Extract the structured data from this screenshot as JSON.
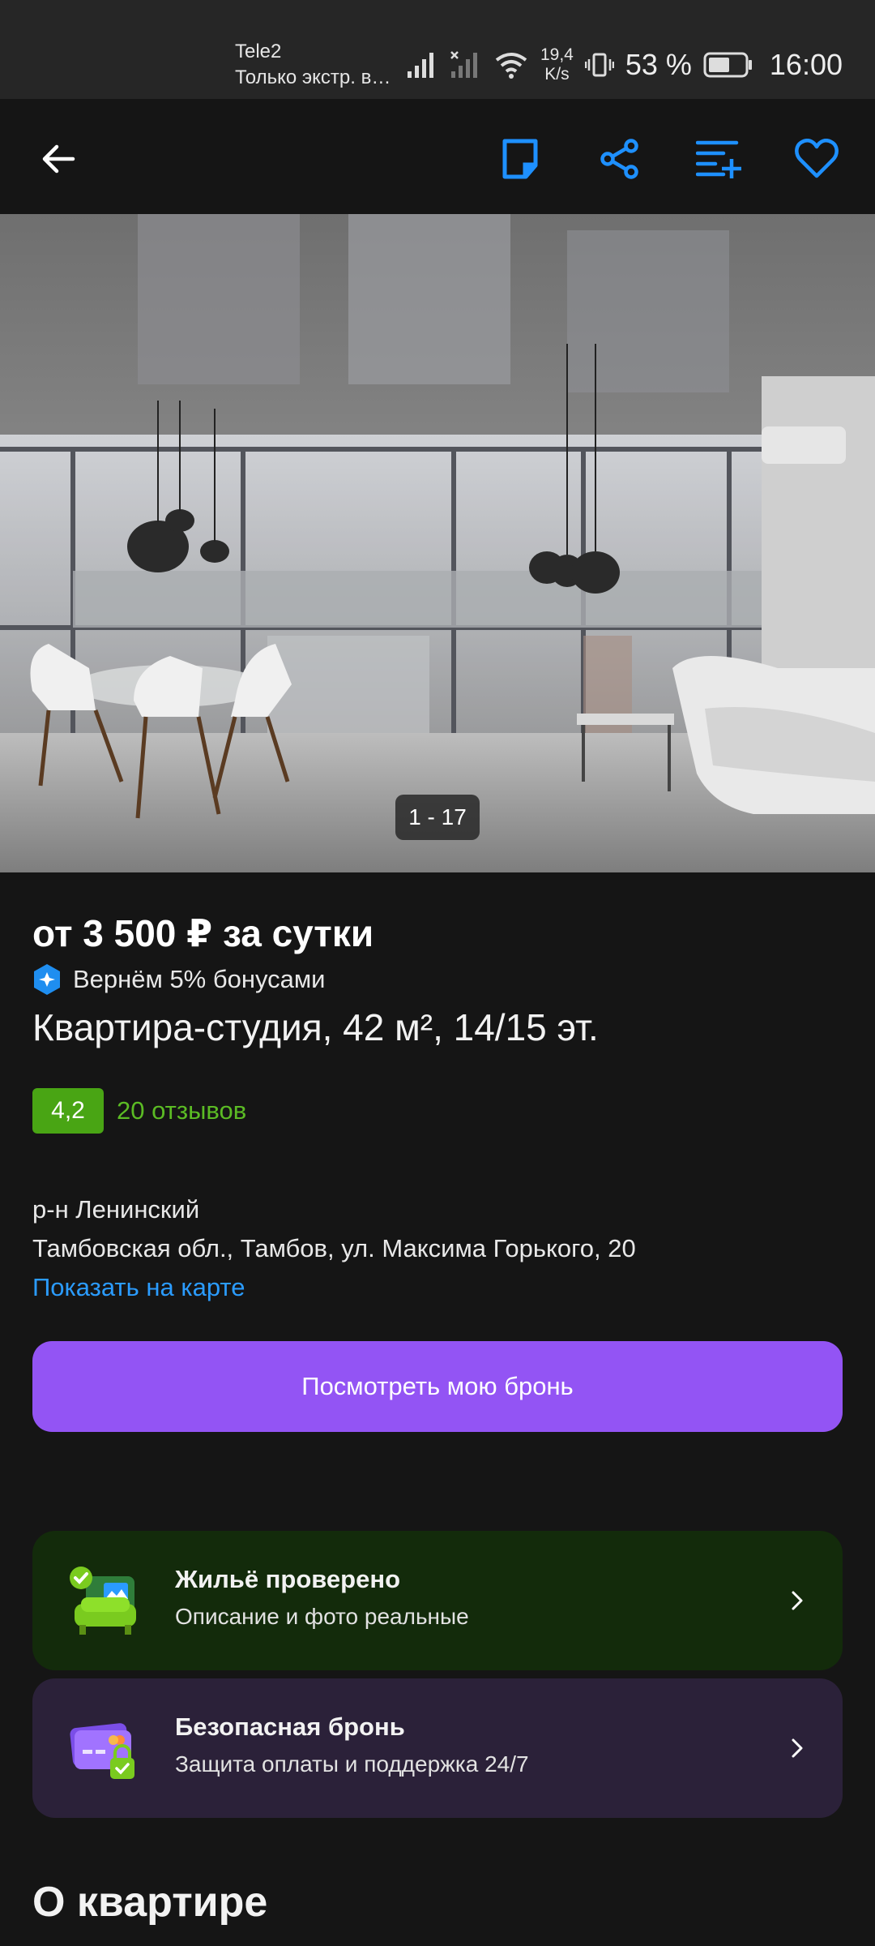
{
  "status_bar": {
    "carrier": "Tele2",
    "carrier_status": "Только экстр. в…",
    "speed_value": "19,4",
    "speed_unit": "K/s",
    "battery_percent": "53 %",
    "time": "16:00"
  },
  "nav": {
    "back_icon": "arrow-left-icon",
    "icons": [
      "note-icon",
      "share-icon",
      "compare-list-icon",
      "heart-icon"
    ],
    "accent_color": "#1e90ff"
  },
  "gallery": {
    "counter": "1 - 17"
  },
  "listing": {
    "price": "от 3 500 ₽ за сутки",
    "bonus": "Вернём 5% бонусами",
    "title": "Квартира-студия, 42 м², 14/15 эт.",
    "rating": "4,2",
    "reviews": "20 отзывов",
    "district": "р-н Ленинский",
    "address": "Тамбовская обл., Тамбов, ул. Максима Горького, 20",
    "map_link": "Показать на карте",
    "booking_button": "Посмотреть мою бронь"
  },
  "cards": [
    {
      "title": "Жильё проверено",
      "subtitle": "Описание и фото реальные",
      "icon": "verified-home-icon",
      "bg": "#132b0b"
    },
    {
      "title": "Безопасная бронь",
      "subtitle": "Защита оплаты и поддержка 24/7",
      "icon": "secure-card-icon",
      "bg": "#2b2139"
    }
  ],
  "section": {
    "title": "О квартире"
  },
  "colors": {
    "background": "#151515",
    "booking_button": "#9354f4",
    "rating_badge": "#49a514",
    "reviews": "#5bbb24",
    "link": "#2b9cff"
  }
}
